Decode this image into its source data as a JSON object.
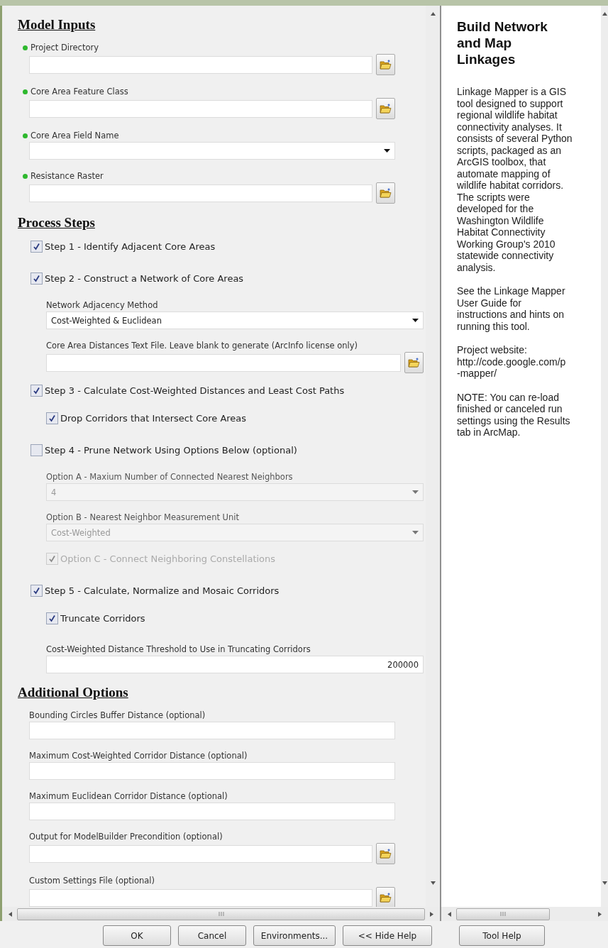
{
  "sections": [
    {
      "title": "Model Inputs",
      "items": [
        {
          "kind": "browse",
          "label": "Project Directory",
          "required": true
        },
        {
          "kind": "browse",
          "label": "Core Area Feature Class",
          "required": true
        },
        {
          "kind": "dropdown",
          "label": "Core Area Field Name",
          "required": true
        },
        {
          "kind": "browse",
          "label": "Resistance Raster",
          "required": true
        }
      ]
    },
    {
      "title": "Process Steps",
      "items": [
        {
          "kind": "checkbox",
          "label": "Step 1 - Identify Adjacent Core Areas",
          "checked": true
        },
        {
          "kind": "checkbox",
          "label": "Step 2 - Construct a Network of Core Areas",
          "checked": true,
          "children": [
            {
              "kind": "dropdown",
              "label": "Network Adjacency Method",
              "value": "Cost-Weighted & Euclidean"
            },
            {
              "kind": "browse",
              "label": "Core Area Distances Text File. Leave blank to generate (ArcInfo license only)"
            }
          ]
        },
        {
          "kind": "checkbox",
          "label": "Step 3 - Calculate Cost-Weighted Distances and Least Cost Paths",
          "checked": true,
          "children": [
            {
              "kind": "checkbox",
              "label": "Drop Corridors that Intersect Core Areas",
              "checked": true
            }
          ]
        },
        {
          "kind": "checkbox",
          "label": "Step 4 - Prune Network Using Options Below (optional)",
          "checked": false,
          "children": [
            {
              "kind": "dropdown",
              "label": "Option A - Maxium Number of Connected Nearest Neighbors",
              "value": "4",
              "disabled": true
            },
            {
              "kind": "dropdown",
              "label": "Option B - Nearest Neighbor Measurement Unit",
              "value": "Cost-Weighted",
              "disabled": true
            },
            {
              "kind": "checkbox",
              "label": "Option C - Connect Neighboring Constellations",
              "checked": true,
              "disabled": true
            }
          ]
        },
        {
          "kind": "checkbox",
          "label": "Step 5 - Calculate, Normalize and Mosaic Corridors",
          "checked": true,
          "children": [
            {
              "kind": "checkbox",
              "label": "Truncate Corridors",
              "checked": true
            },
            {
              "kind": "text",
              "label": "Cost-Weighted Distance Threshold to Use in Truncating Corridors",
              "value": "200000"
            }
          ]
        }
      ]
    },
    {
      "title": "Additional Options",
      "items": [
        {
          "kind": "text",
          "label": "Bounding Circles Buffer Distance (optional)"
        },
        {
          "kind": "text",
          "label": "Maximum Cost-Weighted Corridor Distance (optional)"
        },
        {
          "kind": "text",
          "label": "Maximum Euclidean Corridor Distance (optional)"
        },
        {
          "kind": "browse",
          "label": "Output for ModelBuilder Precondition (optional)"
        },
        {
          "kind": "browse",
          "label": "Custom Settings File (optional)"
        }
      ]
    }
  ],
  "help": {
    "title": "Build Network and Map Linkages",
    "paragraphs": [
      {
        "kind": "text",
        "text": "Linkage Mapper is a GIS tool designed to support regional wildlife habitat connectivity analyses. It consists of several Python scripts, packaged as an ArcGIS toolbox, that automate mapping of wildlife habitat corridors. The scripts were developed for the Washington Wildlife Habitat Connectivity Working Group's 2010 statewide connectivity analysis."
      },
      {
        "kind": "text",
        "text": "See the Linkage Mapper User Guide for instructions and hints on running this tool."
      },
      {
        "kind": "lines",
        "lines": [
          "Project website:",
          "http://code.google.com/p",
          "-mapper/"
        ]
      },
      {
        "kind": "text",
        "text": "NOTE: You can re-load finished or canceled run settings using the Results tab in ArcMap."
      }
    ]
  },
  "buttons": [
    "OK",
    "Cancel",
    "Environments...",
    "<< Hide Help",
    "Tool Help"
  ]
}
